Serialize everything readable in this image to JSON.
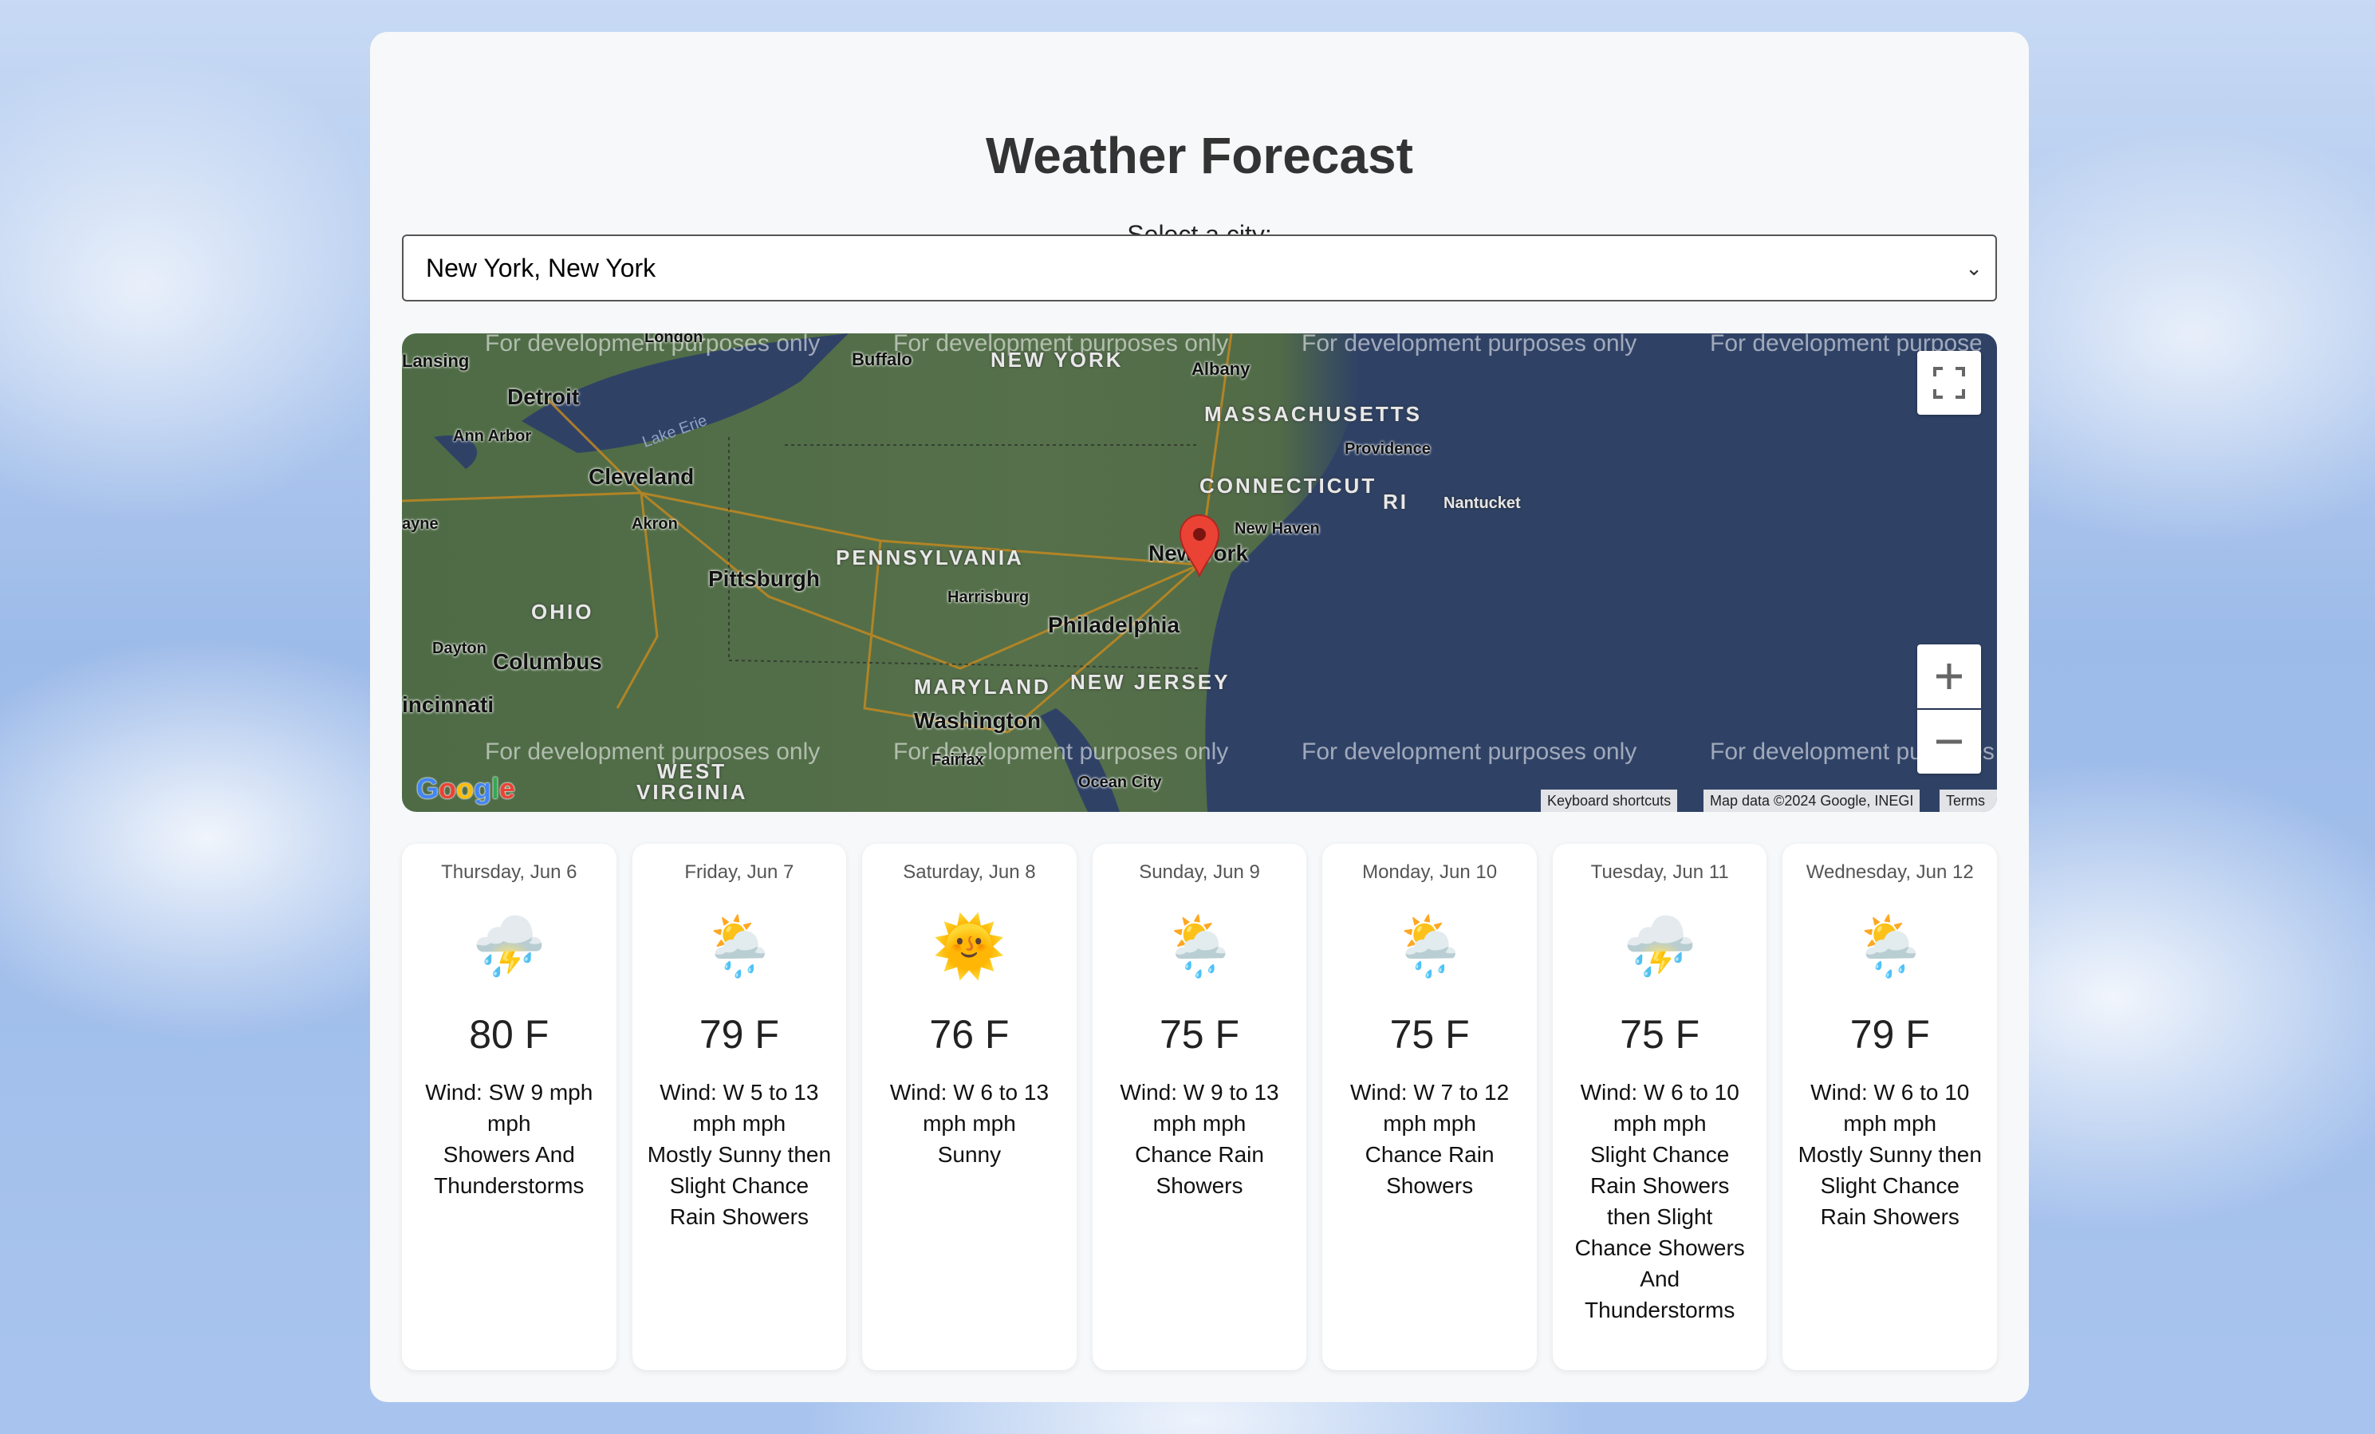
{
  "page": {
    "title": "Weather Forecast",
    "select_label": "Select a city:",
    "selected_city": "New York, New York"
  },
  "map": {
    "watermark": "For development purposes only",
    "places": {
      "lansing": "Lansing",
      "detroit": "Detroit",
      "ann_arbor": "Ann Arbor",
      "cleveland": "Cleveland",
      "akron": "Akron",
      "pittsburgh": "Pittsburgh",
      "columbus": "Columbus",
      "dayton": "Dayton",
      "cincinnati": "incinnati",
      "wayne": "ayne",
      "buffalo": "Buffalo",
      "albany": "Albany",
      "providence": "Providence",
      "nantucket": "Nantucket",
      "new_haven": "New Haven",
      "new_york": "New York",
      "harrisburg": "Harrisburg",
      "philadelphia": "Philadelphia",
      "washington": "Washington",
      "fairfax": "Fairfax",
      "ocean_city": "Ocean City",
      "london": "London",
      "lake_erie": "Lake Erie"
    },
    "states": {
      "new_york": "NEW YORK",
      "massachusetts": "MASSACHUSETTS",
      "connecticut": "CONNECTICUT",
      "ri": "RI",
      "pennsylvania": "PENNSYLVANIA",
      "ohio": "OHIO",
      "maryland": "MARYLAND",
      "new_jersey": "NEW JERSEY",
      "west": "WEST",
      "virginia": "VIRGINIA"
    },
    "attribution": {
      "shortcuts": "Keyboard shortcuts",
      "data": "Map data ©2024 Google, INEGI",
      "terms": "Terms"
    },
    "logo": "Google"
  },
  "forecast": [
    {
      "day": "Thursday, Jun 6",
      "icon": "thunderstorm-icon",
      "glyph": "⛈️",
      "temp": "80 F",
      "wind": "Wind: SW 9 mph mph",
      "summary": "Showers And Thunderstorms"
    },
    {
      "day": "Friday, Jun 7",
      "icon": "sun-rain-icon",
      "glyph": "🌦️",
      "temp": "79 F",
      "wind": "Wind: W 5 to 13 mph mph",
      "summary": "Mostly Sunny then Slight Chance Rain Showers"
    },
    {
      "day": "Saturday, Jun 8",
      "icon": "sun-icon",
      "glyph": "🌞",
      "temp": "76 F",
      "wind": "Wind: W 6 to 13 mph mph",
      "summary": "Sunny"
    },
    {
      "day": "Sunday, Jun 9",
      "icon": "sun-rain-icon",
      "glyph": "🌦️",
      "temp": "75 F",
      "wind": "Wind: W 9 to 13 mph mph",
      "summary": "Chance Rain Showers"
    },
    {
      "day": "Monday, Jun 10",
      "icon": "sun-rain-icon",
      "glyph": "🌦️",
      "temp": "75 F",
      "wind": "Wind: W 7 to 12 mph mph",
      "summary": "Chance Rain Showers"
    },
    {
      "day": "Tuesday, Jun 11",
      "icon": "thunderstorm-icon",
      "glyph": "⛈️",
      "temp": "75 F",
      "wind": "Wind: W 6 to 10 mph mph",
      "summary": "Slight Chance Rain Showers then Slight Chance Showers And Thunderstorms"
    },
    {
      "day": "Wednesday, Jun 12",
      "icon": "sun-rain-icon",
      "glyph": "🌦️",
      "temp": "79 F",
      "wind": "Wind: W 6 to 10 mph mph",
      "summary": "Mostly Sunny then Slight Chance Rain Showers"
    }
  ]
}
